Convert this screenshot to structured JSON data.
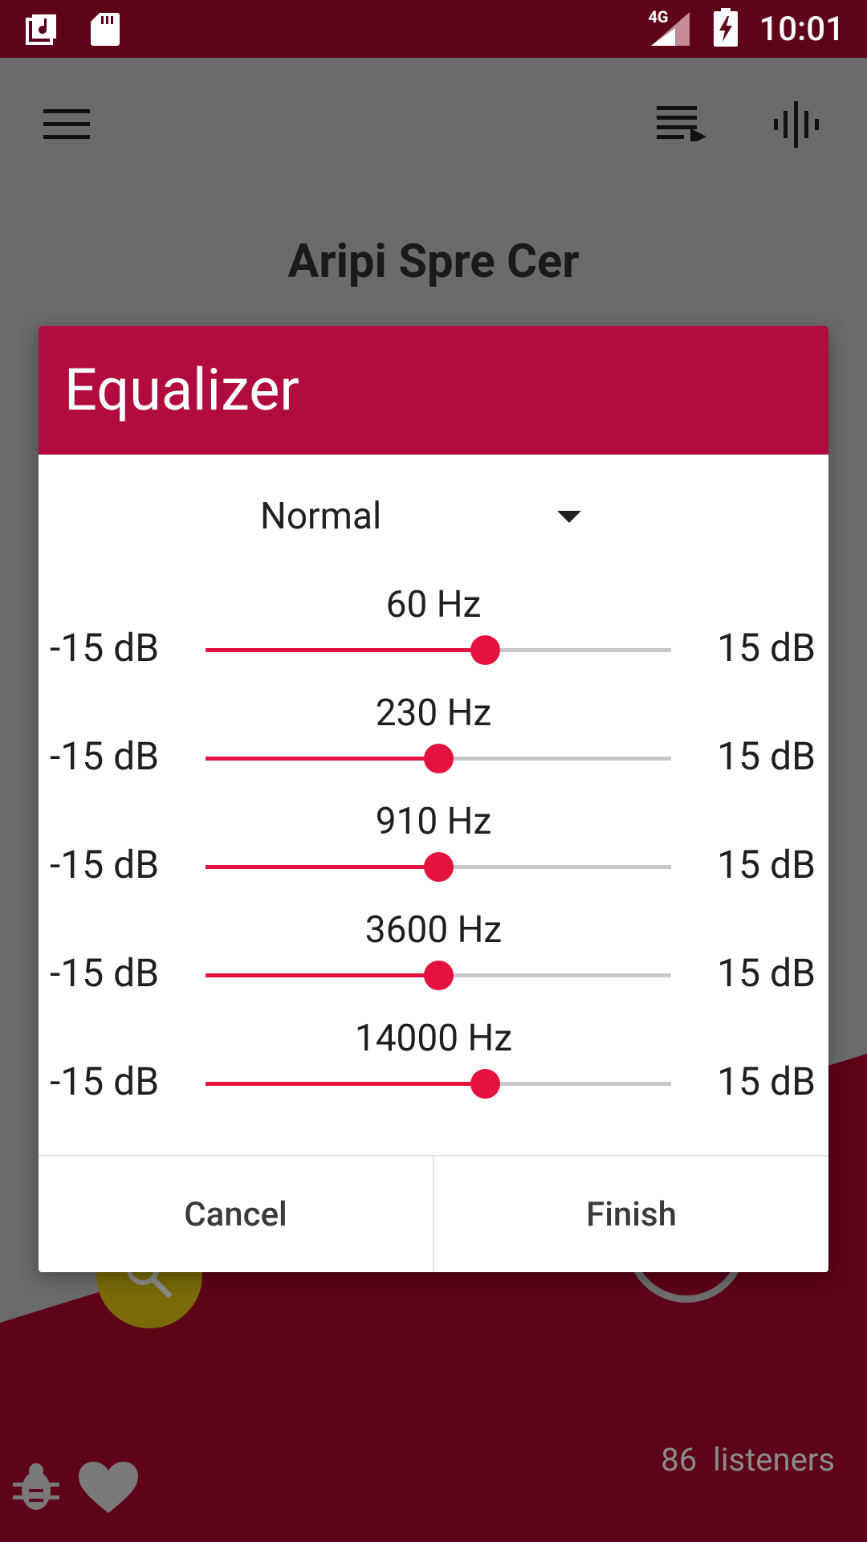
{
  "status_bar": {
    "time": "10:01",
    "network": "4G",
    "icons": [
      "music-library-icon",
      "sd-card-icon",
      "signal-icon",
      "battery-charging-icon"
    ]
  },
  "toolbar": {
    "icons": [
      "menu-icon",
      "queue-icon",
      "audio-visualizer-icon"
    ]
  },
  "track": {
    "title": "Aripi Spre Cer"
  },
  "footer": {
    "listeners": "86  listeners",
    "icons": [
      "bug-icon",
      "heart-icon",
      "search-icon"
    ]
  },
  "dialog": {
    "title": "Equalizer",
    "preset": "Normal",
    "bands": [
      {
        "freq": "60 Hz",
        "min": "-15 dB",
        "max": "15 dB",
        "level": 0.6
      },
      {
        "freq": "230 Hz",
        "min": "-15 dB",
        "max": "15 dB",
        "level": 0.5
      },
      {
        "freq": "910 Hz",
        "min": "-15 dB",
        "max": "15 dB",
        "level": 0.5
      },
      {
        "freq": "3600 Hz",
        "min": "-15 dB",
        "max": "15 dB",
        "level": 0.5
      },
      {
        "freq": "14000 Hz",
        "min": "-15 dB",
        "max": "15 dB",
        "level": 0.6
      }
    ],
    "cancel_label": "Cancel",
    "finish_label": "Finish"
  },
  "colors": {
    "primary_dark": "#5e0418",
    "dialog_header": "#b20c3f",
    "accent": "#e3123f",
    "scrim_gray": "#6b6b6b"
  }
}
